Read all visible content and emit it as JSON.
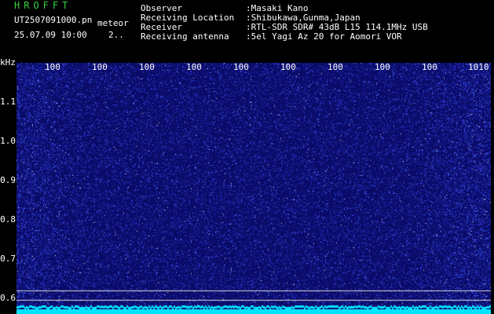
{
  "header": {
    "app_title": "HROFFT",
    "file_name": "UT2507091000.pn",
    "file_suffix": "meteor",
    "timestamp": "25.07.09 10:00",
    "count_value": "2.."
  },
  "info": [
    {
      "label": "Observer",
      "value": ":Masaki Kano"
    },
    {
      "label": "Receiving Location",
      "value": ":Shibukawa,Gunma,Japan"
    },
    {
      "label": "Receiver",
      "value": ":RTL-SDR SDR# 43dB L15 114.1MHz USB"
    },
    {
      "label": "Receiving antenna",
      "value": ":5el Yagi Az 20 for Aomori VOR"
    }
  ],
  "spectrogram": {
    "y_unit": "kHz",
    "y_ticks": [
      "1.1",
      "1.0",
      "0.9",
      "0.8",
      "0.7",
      "0.6"
    ],
    "time_labels": [
      "100",
      "100",
      "100",
      "100",
      "100",
      "100",
      "100",
      "100",
      "100",
      "1010"
    ],
    "colors": {
      "background": "#0b0b6a",
      "noise": "#3b5bff",
      "bright": "#ffffff",
      "baseline": "#00e5ff",
      "guide": "#d9d9d9"
    }
  }
}
